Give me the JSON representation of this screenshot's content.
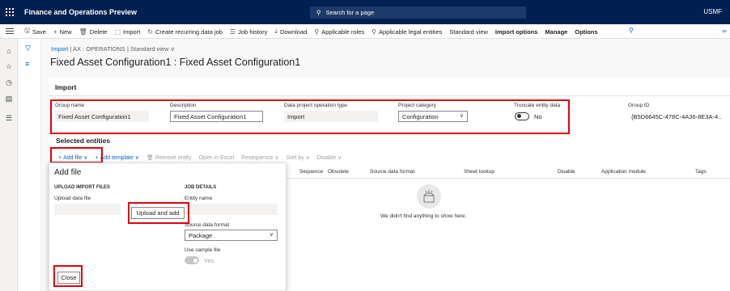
{
  "app": {
    "title": "Finance and Operations Preview",
    "search_placeholder": "Search for a page",
    "company": "USMF"
  },
  "actions": [
    {
      "label": "Save",
      "icon": "save-icon",
      "glyph": "🖫",
      "bold": false
    },
    {
      "label": "New",
      "icon": "plus-icon",
      "glyph": "+",
      "bold": false
    },
    {
      "label": "Delete",
      "icon": "trash-icon",
      "glyph": "🗑",
      "bold": false
    },
    {
      "label": "Import",
      "icon": "import-icon",
      "glyph": "⬚",
      "bold": false
    },
    {
      "label": "Create recurring data job",
      "icon": "recurring-icon",
      "glyph": "↻",
      "bold": false
    },
    {
      "label": "Job history",
      "icon": "history-icon",
      "glyph": "☰",
      "bold": false
    },
    {
      "label": "Download",
      "icon": "download-icon",
      "glyph": "⤓",
      "bold": false
    },
    {
      "label": "Applicable roles",
      "icon": "roles-icon",
      "glyph": "⚲",
      "bold": false
    },
    {
      "label": "Applicable legal entities",
      "icon": "entities-icon",
      "glyph": "⚲",
      "bold": false
    },
    {
      "label": "Standard view",
      "icon": "",
      "glyph": "",
      "bold": false
    },
    {
      "label": "Import options",
      "icon": "",
      "glyph": "",
      "bold": true
    },
    {
      "label": "Manage",
      "icon": "",
      "glyph": "",
      "bold": true
    },
    {
      "label": "Options",
      "icon": "",
      "glyph": "",
      "bold": true
    }
  ],
  "breadcrumb": {
    "link": "Import",
    "sep1": "|",
    "area": "AX : OPERATIONS",
    "sep2": "|",
    "view": "Standard view ∨"
  },
  "page_title": "Fixed Asset Configuration1 : Fixed Asset Configuration1",
  "import_section": {
    "title": "Import",
    "group_name_label": "Group name",
    "group_name": "Fixed Asset Configuration1",
    "description_label": "Description",
    "description": "Fixed Asset Configuration1",
    "operation_type_label": "Data project operation type",
    "operation_type": "Import",
    "project_category_label": "Project category",
    "project_category": "Configuration",
    "truncate_label": "Truncate entity data",
    "truncate_value": "No",
    "group_id_label": "Group ID",
    "group_id": "{B5D6645C-478C-4A36-8E3A-4..."
  },
  "selected_entities": {
    "title": "Selected entities",
    "toolbar": [
      {
        "label": "Add file ∨",
        "glyph": "+",
        "disabled": false,
        "name": "add-file-button"
      },
      {
        "label": "Add template ∨",
        "glyph": "+",
        "disabled": false,
        "name": "add-template-button"
      },
      {
        "label": "Remove entity",
        "glyph": "🗑",
        "disabled": true,
        "name": "remove-entity-button"
      },
      {
        "label": "Open in Excel",
        "glyph": "",
        "disabled": true,
        "name": "open-in-excel-button"
      },
      {
        "label": "Resequence ∨",
        "glyph": "",
        "disabled": true,
        "name": "resequence-button"
      },
      {
        "label": "Sort by ∨",
        "glyph": "",
        "disabled": true,
        "name": "sort-by-button"
      },
      {
        "label": "Disable ∨",
        "glyph": "",
        "disabled": true,
        "name": "disable-button"
      }
    ],
    "columns": [
      "Sequence",
      "Obsolete",
      "Source data format",
      "Sheet lookup",
      "Disable",
      "Application module",
      "Tags"
    ],
    "empty_message": "We didn't find anything to show here."
  },
  "add_file": {
    "title": "Add file",
    "upload_header": "UPLOAD IMPORT FILES",
    "upload_label": "Upload data file",
    "upload_button": "Upload and add",
    "job_header": "JOB DETAILS",
    "entity_label": "Entity name",
    "source_format_label": "Source data format",
    "source_format": "Package",
    "sample_label": "Use sample file",
    "sample_value": "Yes",
    "close_button": "Close"
  },
  "colors": {
    "topbar": "#002050",
    "link": "#0066cc",
    "highlight": "#e3000f"
  }
}
